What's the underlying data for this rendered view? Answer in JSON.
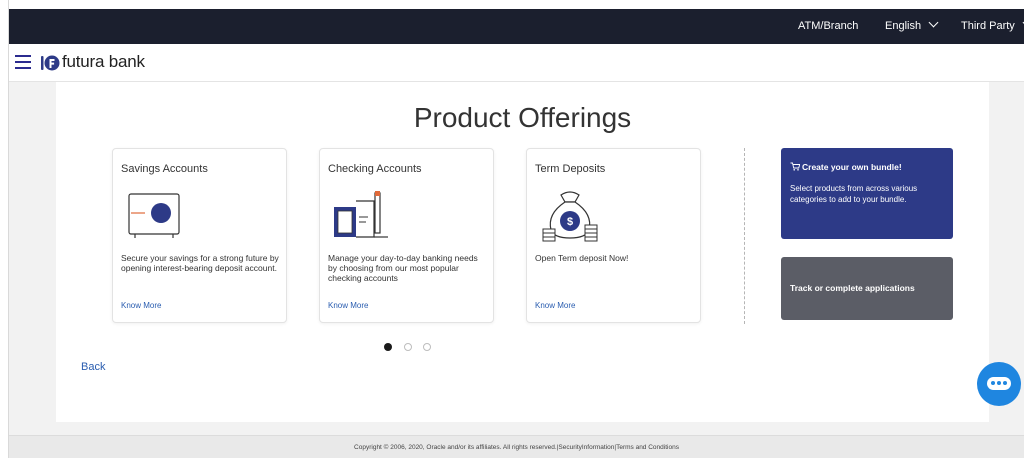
{
  "topbar": {
    "atm_branch": "ATM/Branch",
    "language": "English",
    "third_party": "Third Party"
  },
  "header": {
    "brand": "futura bank"
  },
  "main": {
    "title": "Product Offerings",
    "cards": [
      {
        "title": "Savings Accounts",
        "icon": "safe-icon",
        "description": "Secure your savings for a strong future by opening interest-bearing deposit account.",
        "link": "Know More"
      },
      {
        "title": "Checking Accounts",
        "icon": "checkbook-icon",
        "description": "Manage your day-to-day banking needs by choosing from our most popular checking accounts",
        "link": "Know More"
      },
      {
        "title": "Term Deposits",
        "icon": "money-bag-icon",
        "description": "Open Term deposit Now!",
        "link": "Know More"
      }
    ],
    "bundle": {
      "title": "Create your own bundle!",
      "description": "Select products from across various categories to add to your bundle."
    },
    "track": {
      "title": "Track or complete applications"
    },
    "carousel": {
      "active_page": 1,
      "total_pages": 3
    },
    "back": "Back"
  },
  "footer": {
    "text": "Copyright © 2006, 2020, Oracle and/or its affiliates. All rights reserved.|SecurityInformation|Terms and Conditions"
  },
  "colors": {
    "topbar": "#1b1f2e",
    "brand_blue": "#2d3a87",
    "track_gray": "#5b5d66",
    "link_blue": "#2a5db0",
    "chat_blue": "#1f86e0"
  }
}
